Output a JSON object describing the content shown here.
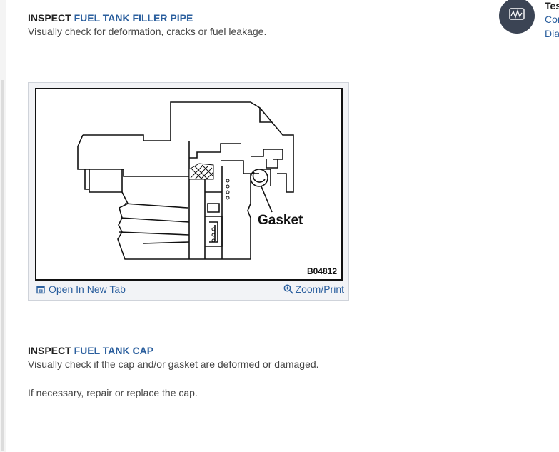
{
  "step1": {
    "prefix": "INSPECT",
    "link": "FUEL TANK FILLER PIPE",
    "text": "Visually check for deformation, cracks or fuel leakage."
  },
  "figure": {
    "callout": "Gasket",
    "code": "B04812",
    "open_tab_label": "Open In New Tab",
    "zoom_label": "Zoom/Print"
  },
  "step2": {
    "prefix": "INSPECT",
    "link": "FUEL TANK CAP",
    "text1": "Visually check if the cap and/or gasket are deformed or damaged.",
    "text2": "If necessary, repair or replace the cap."
  },
  "side_card": {
    "title": "Tes",
    "line1": "Cor",
    "line2": "Dia",
    "icon": "waveform-icon"
  },
  "colors": {
    "link": "#2b5f9e",
    "badge": "#3b4454"
  }
}
